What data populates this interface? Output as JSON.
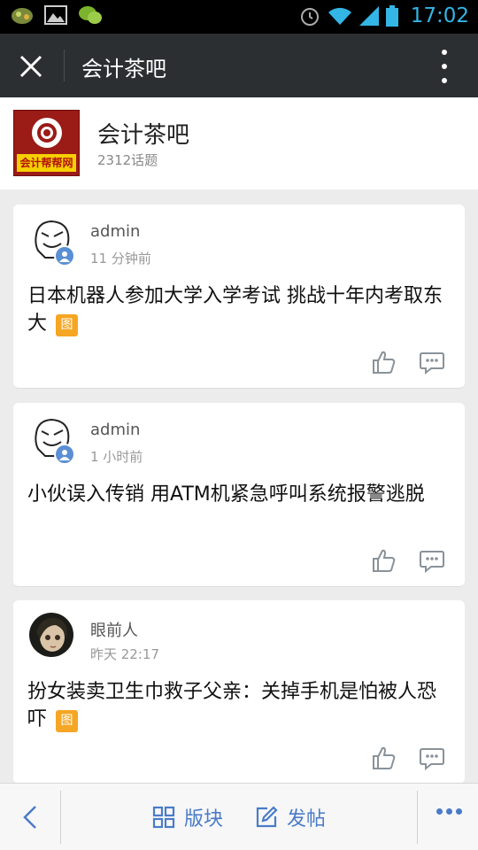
{
  "status_bar": {
    "time": "17:02"
  },
  "app_bar": {
    "title": "会计茶吧"
  },
  "forum": {
    "name": "会计茶吧",
    "topic_count": "2312话题",
    "logo_text": "会计帮帮网"
  },
  "posts": [
    {
      "author": "admin",
      "time": "11 分钟前",
      "title": "日本机器人参加大学入学考试 挑战十年内考取东大",
      "has_image_tag": true,
      "avatar": "meme-face-avatar"
    },
    {
      "author": "admin",
      "time": "1 小时前",
      "title": "小伙误入传销 用ATM机紧急呼叫系统报警逃脱",
      "has_image_tag": false,
      "avatar": "meme-face-avatar"
    },
    {
      "author": "眼前人",
      "time": "昨天 22:17",
      "title": "扮女装卖卫生巾救子父亲：关掉手机是怕被人恐吓",
      "has_image_tag": true,
      "avatar": "doll-avatar"
    }
  ],
  "image_tag_label": "图",
  "bottom_bar": {
    "section_label": "版块",
    "post_label": "发帖"
  },
  "colors": {
    "accent": "#4a7bc8",
    "tag": "#f5a623",
    "app_bar": "#2b2f31",
    "status_text": "#33b5e5"
  }
}
